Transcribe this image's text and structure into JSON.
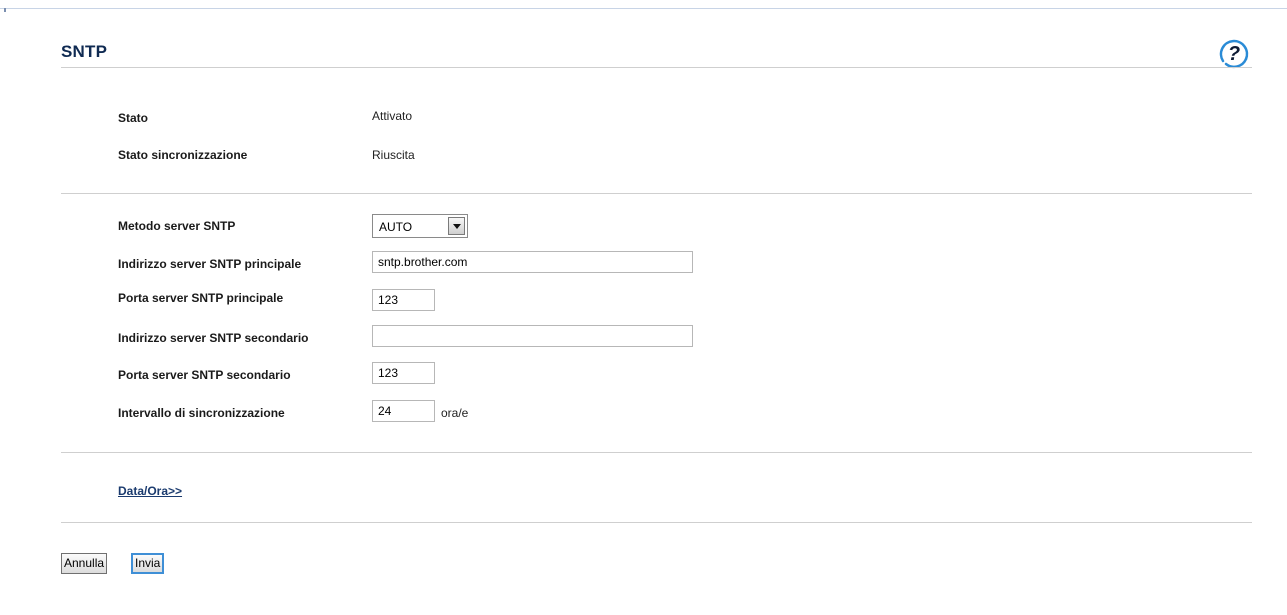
{
  "page": {
    "title": "SNTP",
    "help_icon": "help-question-icon"
  },
  "status": {
    "state_label": "Stato",
    "state_value": "Attivato",
    "sync_label": "Stato sincronizzazione",
    "sync_value": "Riuscita"
  },
  "settings": {
    "method_label": "Metodo server SNTP",
    "method_value": "AUTO",
    "primary_address_label": "Indirizzo server SNTP principale",
    "primary_address_value": "sntp.brother.com",
    "primary_port_label": "Porta server SNTP principale",
    "primary_port_value": "123",
    "secondary_address_label": "Indirizzo server SNTP secondario",
    "secondary_address_value": "",
    "secondary_port_label": "Porta server SNTP secondario",
    "secondary_port_value": "123",
    "interval_label": "Intervallo di sincronizzazione",
    "interval_value": "24",
    "interval_unit": "ora/e"
  },
  "links": {
    "date_time": "Data/Ora>>"
  },
  "actions": {
    "cancel_label": "Annulla",
    "submit_label": "Invia"
  },
  "colors": {
    "title": "#0f2a52",
    "link": "#1a3a6e",
    "help_icon_ring": "#2a8bd6",
    "submit_border": "#3f8fd6"
  }
}
